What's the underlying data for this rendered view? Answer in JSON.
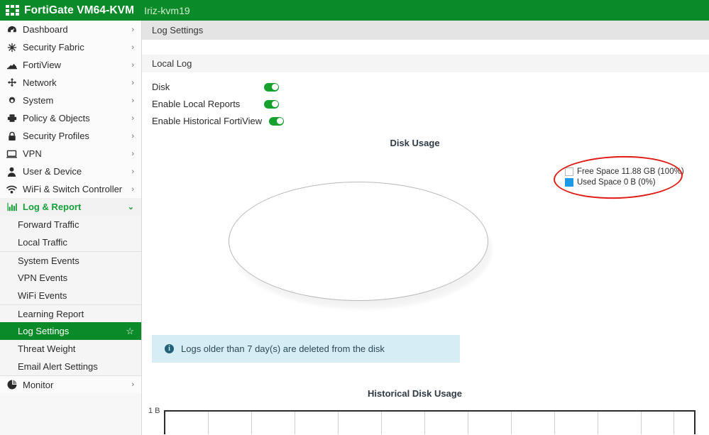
{
  "header": {
    "brand": "FortiGate VM64-KVM",
    "hostname": "Iriz-kvm19",
    "logo_icon": "fortinet-grid-logo"
  },
  "sidebar": {
    "items": [
      {
        "label": "Dashboard",
        "icon": "dashboard-gauge-icon",
        "chevron": "›"
      },
      {
        "label": "Security Fabric",
        "icon": "security-fabric-icon",
        "chevron": "›"
      },
      {
        "label": "FortiView",
        "icon": "fortiview-mountain-icon",
        "chevron": "›"
      },
      {
        "label": "Network",
        "icon": "network-move-icon",
        "chevron": "›"
      },
      {
        "label": "System",
        "icon": "gear-icon",
        "chevron": "›"
      },
      {
        "label": "Policy & Objects",
        "icon": "policy-objects-icon",
        "chevron": "›"
      },
      {
        "label": "Security Profiles",
        "icon": "lock-icon",
        "chevron": "›"
      },
      {
        "label": "VPN",
        "icon": "monitor-icon",
        "chevron": "›"
      },
      {
        "label": "User & Device",
        "icon": "user-icon",
        "chevron": "›"
      },
      {
        "label": "WiFi & Switch Controller",
        "icon": "wifi-icon",
        "chevron": "›"
      }
    ],
    "log_report": {
      "label": "Log & Report",
      "icon": "bar-chart-icon",
      "chevron": "⌄",
      "expanded": true
    },
    "sub_items": [
      {
        "label": "Forward Traffic",
        "active": false,
        "separator": false
      },
      {
        "label": "Local Traffic",
        "active": false,
        "separator": false
      },
      {
        "label": "System Events",
        "active": false,
        "separator": true
      },
      {
        "label": "VPN Events",
        "active": false,
        "separator": false
      },
      {
        "label": "WiFi Events",
        "active": false,
        "separator": false
      },
      {
        "label": "Learning Report",
        "active": false,
        "separator": true
      },
      {
        "label": "Log Settings",
        "active": true,
        "separator": false,
        "star_icon": "☆"
      },
      {
        "label": "Threat Weight",
        "active": false,
        "separator": false
      },
      {
        "label": "Email Alert Settings",
        "active": false,
        "separator": false
      }
    ],
    "monitor": {
      "label": "Monitor",
      "icon": "pie-chart-icon",
      "chevron": "›"
    }
  },
  "main": {
    "page_title": "Log Settings",
    "section_title": "Local Log",
    "settings": [
      {
        "label": "Disk",
        "toggle_on": true,
        "name": "disk-toggle"
      },
      {
        "label": "Enable Local Reports",
        "toggle_on": true,
        "name": "enable-local-reports-toggle"
      },
      {
        "label": "Enable Historical FortiView",
        "toggle_on": true,
        "name": "enable-historical-fortiview-toggle"
      }
    ],
    "info_banner": {
      "icon": "info-icon",
      "text": "Logs older than 7 day(s) are deleted from the disk"
    }
  },
  "colors": {
    "brand_green": "#0a8a28",
    "active_green": "#0a8a28",
    "toggle_green": "#16a02e",
    "used_space_blue": "#1c9ae8",
    "annotation_red": "#e01b14",
    "info_banner_bg": "#d6edf5"
  },
  "chart_data": [
    {
      "type": "pie",
      "title": "Disk Usage",
      "labels": [
        "Free Space 11.88 GB (100%)",
        "Used Space 0 B (0%)"
      ],
      "slices": [
        {
          "name": "Free Space",
          "value": 11.88,
          "unit": "GB",
          "percent": 100,
          "color": "#ffffff"
        },
        {
          "name": "Used Space",
          "value": 0,
          "unit": "B",
          "percent": 0,
          "color": "#1c9ae8"
        }
      ],
      "legend_position": "right",
      "annotation": "red-ellipse-around-legend"
    },
    {
      "type": "line",
      "title": "Historical Disk Usage",
      "ylabel": "",
      "xlabel": "",
      "ytick_labels": [
        "1 B"
      ],
      "ylim": [
        0,
        1
      ],
      "grid": true,
      "x": [],
      "values": [],
      "note": "chart is cut off at the bottom edge of the screenshot"
    }
  ]
}
